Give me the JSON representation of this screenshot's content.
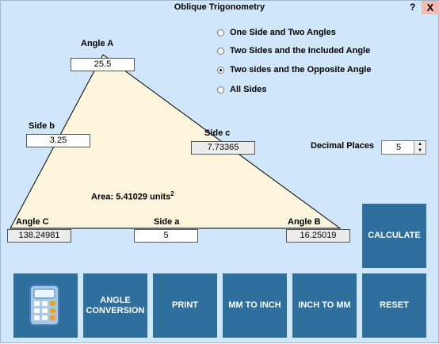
{
  "window": {
    "title": "Oblique Trigonometry",
    "help_label": "?",
    "close_label": "X"
  },
  "triangle": {
    "angle_a": {
      "label": "Angle A",
      "value": "25.5"
    },
    "angle_b": {
      "label": "Angle B",
      "value": "16.25019"
    },
    "angle_c": {
      "label": "Angle C",
      "value": "138.24981"
    },
    "side_a": {
      "label": "Side a",
      "value": "5"
    },
    "side_b": {
      "label": "Side b",
      "value": "3.25"
    },
    "side_c": {
      "label": "Side c",
      "value": "7.73365"
    },
    "area": {
      "label": "Area:",
      "value": "5.41029",
      "unit": "units",
      "unit_power": "2"
    }
  },
  "modes": [
    {
      "label": "One Side and Two Angles",
      "selected": false
    },
    {
      "label": "Two Sides and the Included Angle",
      "selected": false
    },
    {
      "label": "Two sides and the Opposite Angle",
      "selected": true
    },
    {
      "label": "All Sides",
      "selected": false
    }
  ],
  "decimal_places": {
    "label": "Decimal Places",
    "value": "5"
  },
  "buttons": {
    "calculate": "CALCULATE",
    "angle_conversion": "ANGLE CONVERSION",
    "print": "PRINT",
    "mm_to_inch": "MM TO INCH",
    "inch_to_mm": "INCH TO MM",
    "reset": "RESET"
  },
  "colors": {
    "background": "#cfe6fb",
    "triangle_fill": "#fdf5dc",
    "button": "#2e6f9e",
    "close": "#f3b9b3"
  },
  "icons": {
    "calculator": "calculator-icon"
  }
}
